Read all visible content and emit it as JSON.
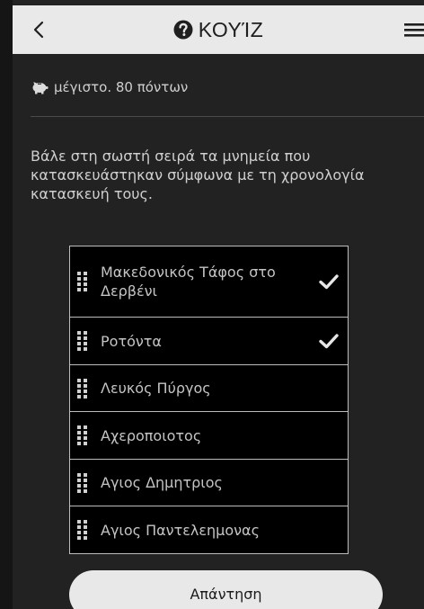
{
  "header": {
    "back_icon": "chevron-left-icon",
    "title_icon": "question-circle-icon",
    "title": "ΚΟΥΊΖ",
    "menu_icon": "hamburger-menu-icon"
  },
  "points": {
    "icon": "piggy-bank-icon",
    "text": "μέγιστο. 80 πόντων"
  },
  "question": {
    "text": "Βάλε στη σωστή σειρά τα μνημεία που κατασκευάστηκαν σύμφωνα με τη χρονολογία κατασκευή τους."
  },
  "answers": [
    {
      "label": "Μακεδονικός Τάφος στο Δερβένι",
      "checked": true
    },
    {
      "label": "Ροτόντα",
      "checked": true
    },
    {
      "label": "Λευκός Πύργος",
      "checked": false
    },
    {
      "label": "Αχεροποιοτος",
      "checked": false
    },
    {
      "label": "Αγιος Δημητριος",
      "checked": false
    },
    {
      "label": "Αγιος Παντελεημονας",
      "checked": false
    }
  ],
  "submit": {
    "label": "Απάντηση"
  },
  "colors": {
    "background": "#222222",
    "header": "#e9e9e9",
    "list_background": "#000000",
    "list_border": "#bdbdbd",
    "button": "#e8e8e8"
  }
}
